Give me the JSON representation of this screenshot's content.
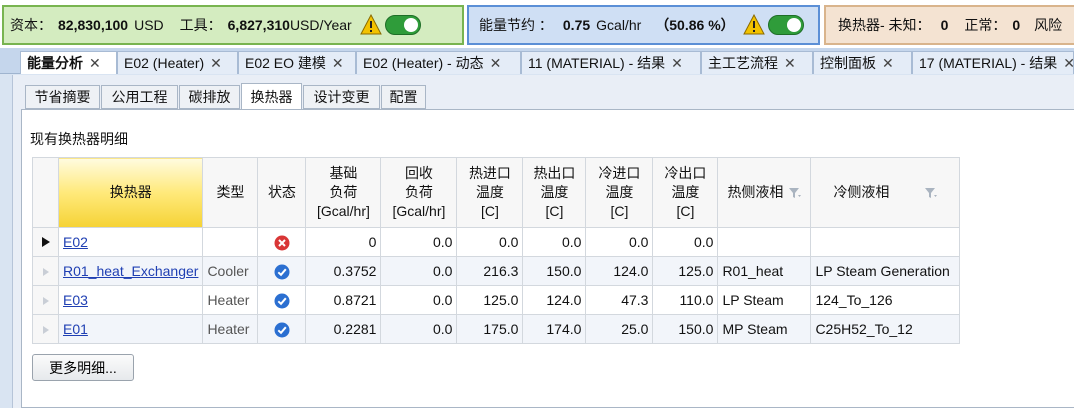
{
  "status_bar": {
    "capital": {
      "label": "资本：",
      "value": "82,830,100",
      "unit": "USD",
      "op_label": "工具：",
      "op_value": "6,827,310",
      "op_unit": "USD/Year"
    },
    "energy": {
      "label": "能量节约 ：",
      "value": "0.75",
      "unit": "Gcal/hr",
      "percent": "（50.86 %）"
    },
    "exchangers": {
      "label": "换热器- 未知：",
      "unknown_count": "0",
      "ok_label": "正常：",
      "ok_count": "0",
      "risk_label": "风险"
    },
    "colors": {
      "capital_bg": "#d4ecc0",
      "energy_bg": "#cfdff4",
      "hx_bg": "#f4e3d2",
      "toggle_on": "#2f9c3a",
      "warning": "#f2c200"
    }
  },
  "doc_tabs": [
    {
      "label": "能量分析",
      "active": true
    },
    {
      "label": "E02 (Heater)",
      "active": false
    },
    {
      "label": "E02 EO 建模",
      "active": false
    },
    {
      "label": "E02 (Heater) - 动态",
      "active": false
    },
    {
      "label": "11 (MATERIAL) - 结果",
      "active": false
    },
    {
      "label": "主工艺流程",
      "active": false
    },
    {
      "label": "控制面板",
      "active": false
    },
    {
      "label": "17 (MATERIAL) - 结果",
      "active": false
    }
  ],
  "close_glyph": "✕",
  "sub_tabs": [
    {
      "label": "节省摘要",
      "active": false
    },
    {
      "label": "公用工程",
      "active": false
    },
    {
      "label": "碳排放",
      "active": false
    },
    {
      "label": "换热器",
      "active": true
    },
    {
      "label": "设计变更",
      "active": false
    },
    {
      "label": "配置",
      "active": false
    }
  ],
  "section_title": "现有换热器明细",
  "table": {
    "headers": [
      "换热器",
      "类型",
      "状态",
      "基础\n负荷\n[Gcal/hr]",
      "回收\n负荷\n[Gcal/hr]",
      "热进口\n温度\n[C]",
      "热出口\n温度\n[C]",
      "冷进口\n温度\n[C]",
      "冷出口\n温度\n[C]",
      "热侧液相",
      "冷侧液相"
    ],
    "rows": [
      {
        "name": "E02",
        "type": "",
        "status": "error",
        "base_duty": "0",
        "recovered_duty": "0.0",
        "hot_in": "0.0",
        "hot_out": "0.0",
        "cold_in": "0.0",
        "cold_out": "0.0",
        "hot_side": "",
        "cold_side": ""
      },
      {
        "name": "R01_heat_Exchanger",
        "type": "Cooler",
        "status": "ok",
        "base_duty": "0.3752",
        "recovered_duty": "0.0",
        "hot_in": "216.3",
        "hot_out": "150.0",
        "cold_in": "124.0",
        "cold_out": "125.0",
        "hot_side": "R01_heat",
        "cold_side": "LP Steam Generation"
      },
      {
        "name": "E03",
        "type": "Heater",
        "status": "ok",
        "base_duty": "0.8721",
        "recovered_duty": "0.0",
        "hot_in": "125.0",
        "hot_out": "124.0",
        "cold_in": "47.3",
        "cold_out": "110.0",
        "hot_side": "LP Steam",
        "cold_side": "124_To_126"
      },
      {
        "name": "E01",
        "type": "Heater",
        "status": "ok",
        "base_duty": "0.2281",
        "recovered_duty": "0.0",
        "hot_in": "175.0",
        "hot_out": "174.0",
        "cold_in": "25.0",
        "cold_out": "150.0",
        "hot_side": "MP Steam",
        "cold_side": "C25H52_To_12"
      }
    ]
  },
  "more_details_label": "更多明细..."
}
